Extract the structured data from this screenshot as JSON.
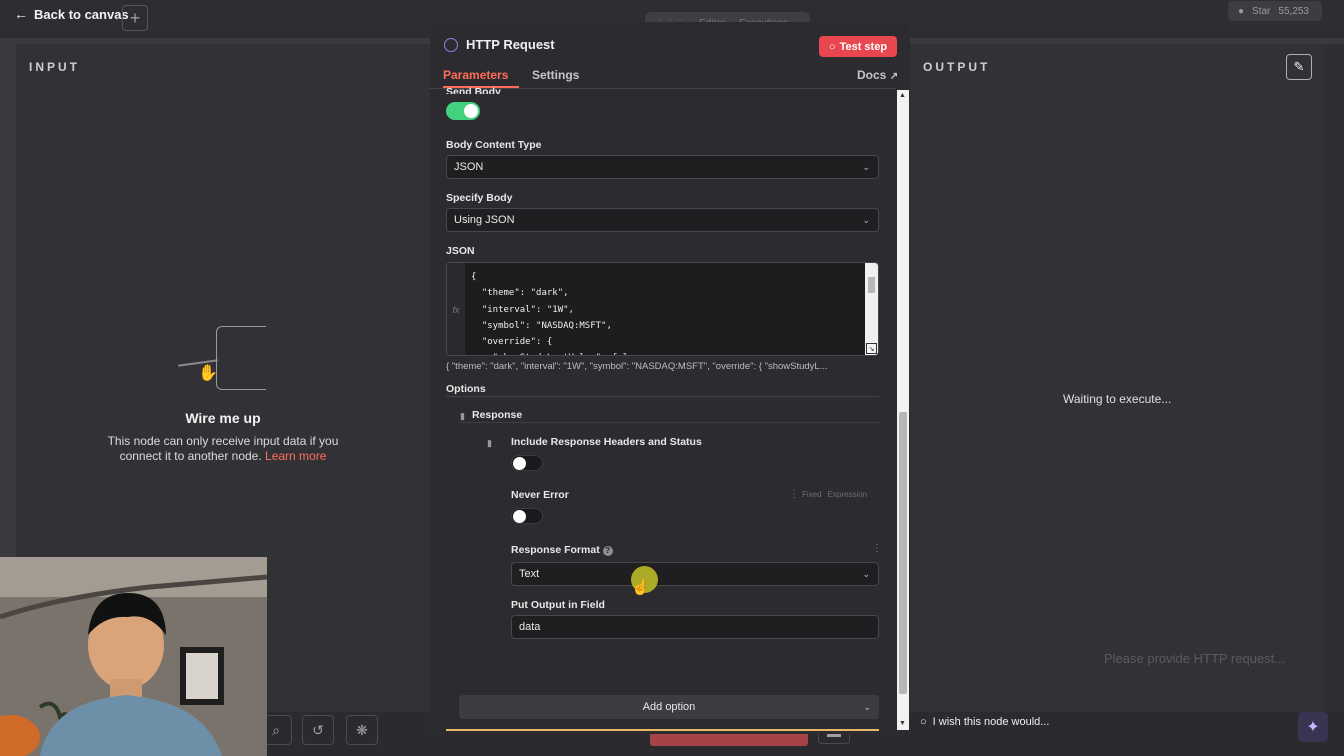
{
  "topbar": {
    "back_label": "Back to canvas",
    "add_symbol": "+",
    "tab_a": "Editor",
    "tab_b": "Executions",
    "star_label": "Star",
    "star_count": "55,253"
  },
  "input_panel": {
    "title": "INPUT",
    "wire_title": "Wire me up",
    "wire_desc": "This node can only receive input data if you connect it to another node.",
    "learn_more": "Learn more"
  },
  "output_panel": {
    "title": "OUTPUT",
    "waiting": "Waiting to execute..."
  },
  "node": {
    "title": "HTTP Request",
    "test_step": "Test step",
    "tabs": [
      "Parameters",
      "Settings"
    ],
    "docs": "Docs",
    "send_body_label": "Send Body",
    "send_body_on": true,
    "body_content_type": {
      "label": "Body Content Type",
      "value": "JSON"
    },
    "specify_body": {
      "label": "Specify Body",
      "value": "Using JSON"
    },
    "json": {
      "label": "JSON",
      "gutter": "fx",
      "code": "{\n  \"theme\": \"dark\",\n  \"interval\": \"1W\",\n  \"symbol\": \"NASDAQ:MSFT\",\n  \"override\": {\n    \"showStudyLastValue\": false",
      "preview": "{  \"theme\": \"dark\",  \"interval\": \"1W\",  \"symbol\": \"NASDAQ:MSFT\",  \"override\": {   \"showStudyL..."
    },
    "options_label": "Options",
    "response": {
      "label": "Response",
      "include_headers_label": "Include Response Headers and Status",
      "include_headers_on": false,
      "never_error_label": "Never Error",
      "never_error_on": false,
      "fixed": "Fixed",
      "expression": "Expression",
      "response_format": {
        "label": "Response Format",
        "help": "?",
        "value": "Text"
      },
      "put_output": {
        "label": "Put Output in Field",
        "value": "data"
      }
    },
    "add_option": "Add option"
  },
  "bottom": {
    "wish": "I wish this node would..."
  },
  "toast_ghost": "Please provide HTTP request..."
}
